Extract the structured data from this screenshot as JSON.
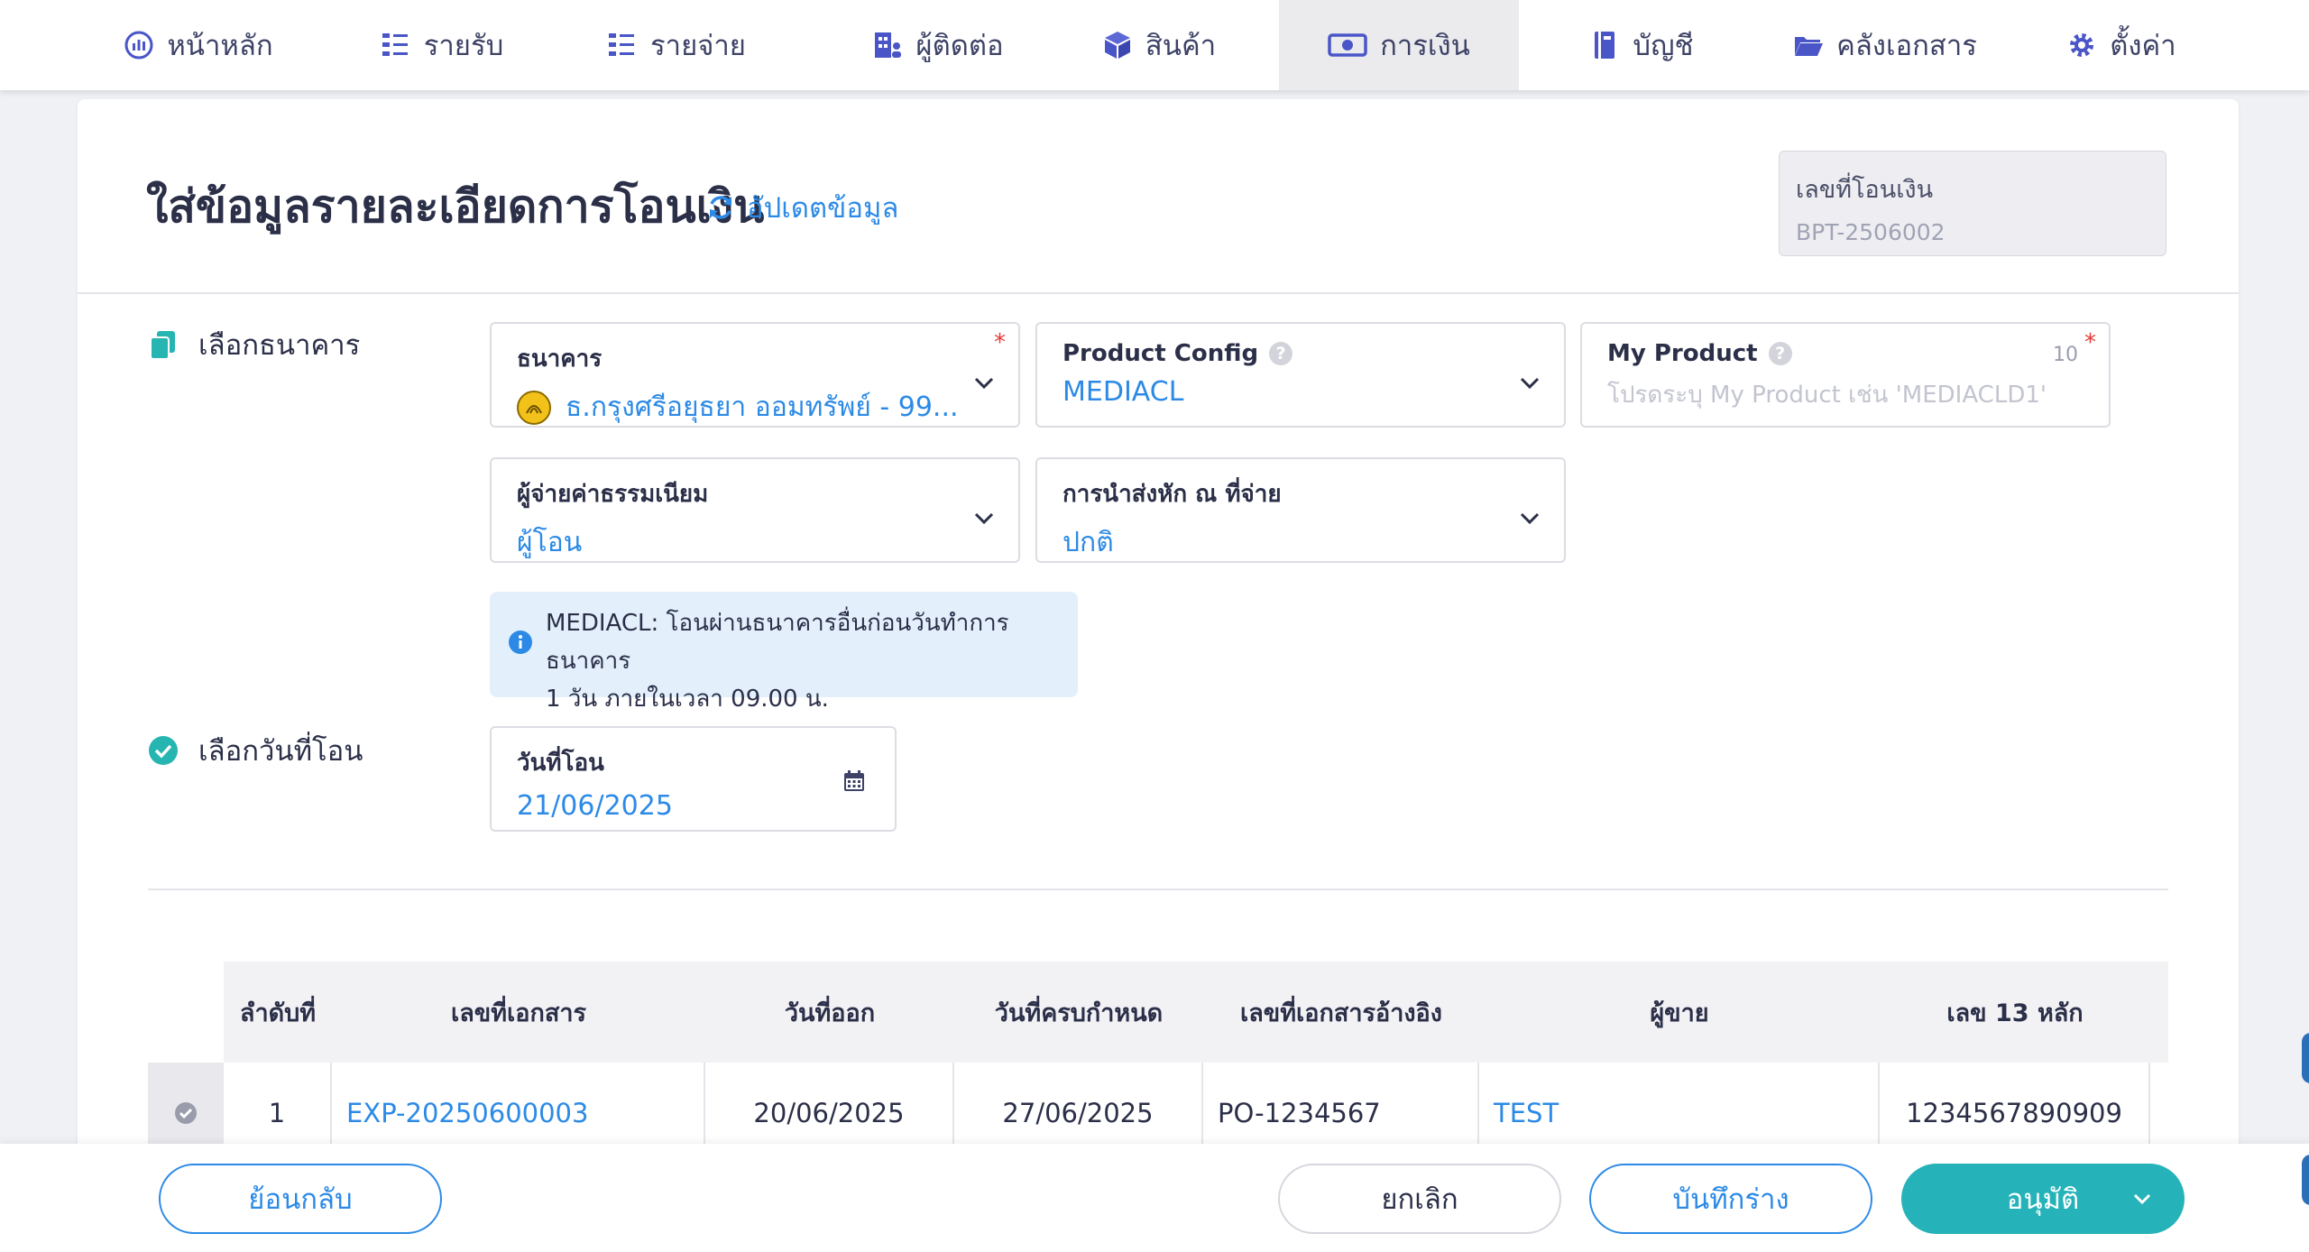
{
  "nav": {
    "items": [
      {
        "label": "หน้าหลัก",
        "icon": "dashboard-icon"
      },
      {
        "label": "รายรับ",
        "icon": "income-list-icon"
      },
      {
        "label": "รายจ่าย",
        "icon": "expense-list-icon"
      },
      {
        "label": "ผู้ติดต่อ",
        "icon": "contacts-icon"
      },
      {
        "label": "สินค้า",
        "icon": "product-box-icon"
      },
      {
        "label": "การเงิน",
        "icon": "money-icon"
      },
      {
        "label": "บัญชี",
        "icon": "ledger-book-icon"
      },
      {
        "label": "คลังเอกสาร",
        "icon": "folder-icon"
      },
      {
        "label": "ตั้งค่า",
        "icon": "gear-icon"
      }
    ],
    "active": "การเงิน"
  },
  "header": {
    "title": "ใส่ข้อมูลรายละเอียดการโอนเงิน",
    "refresh_label": "อัปเดตข้อมูล",
    "doc_no_label": "เลขที่โอนเงิน",
    "doc_no_value": "BPT-2506002"
  },
  "bank_section": {
    "label": "เลือกธนาคาร",
    "bank": {
      "label": "ธนาคาร",
      "value": "ธ.กรุงศรีอยุธยา ออมทรัพย์ - 99...",
      "required": "*"
    },
    "product_config": {
      "label": "Product Config",
      "value": "MEDIACL"
    },
    "my_product": {
      "label": "My Product",
      "placeholder": "โปรดระบุ My Product เช่น 'MEDIACLD1'",
      "counter": "10",
      "required": "*"
    },
    "fee_payer": {
      "label": "ผู้จ่ายค่าธรรมเนียม",
      "value": "ผู้โอน"
    },
    "withholding": {
      "label": "การนำส่งหัก ณ ที่จ่าย",
      "value": "ปกติ"
    },
    "info_line1": "MEDIACL: โอนผ่านธนาคารอื่นก่อนวันทำการธนาคาร",
    "info_line2": "1 วัน ภายในเวลา 09.00 น."
  },
  "date_section": {
    "label": "เลือกวันที่โอน",
    "transfer_date": {
      "label": "วันที่โอน",
      "value": "21/06/2025"
    }
  },
  "table": {
    "headers": [
      "ลำดับที่",
      "เลขที่เอกสาร",
      "วันที่ออก",
      "วันที่ครบกำหนด",
      "เลขที่เอกสารอ้างอิง",
      "ผู้ขาย",
      "เลข 13 หลัก"
    ],
    "rows": [
      [
        "1",
        "EXP-20250600003",
        "20/06/2025",
        "27/06/2025",
        "PO-1234567",
        "TEST",
        "1234567890909"
      ]
    ]
  },
  "actions": {
    "back": "ย้อนกลับ",
    "cancel": "ยกเลิก",
    "draft": "บันทึกร่าง",
    "approve": "อนุมัติ"
  },
  "colors": {
    "accent_blue": "#2c8ae6",
    "approve_teal": "#25b3b9",
    "nav_text": "#3d4266",
    "required_red": "#e53935",
    "check_teal": "#26b5b0"
  }
}
